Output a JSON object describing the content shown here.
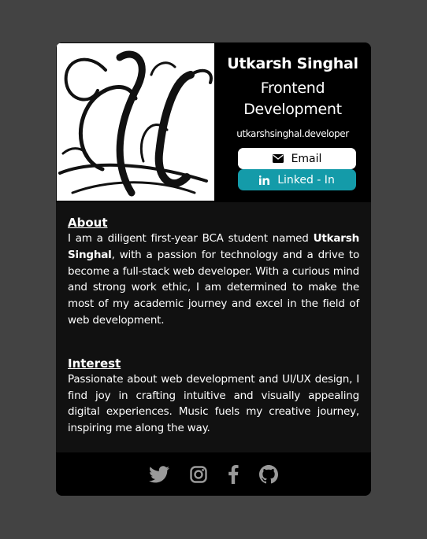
{
  "profile": {
    "name": "Utkarsh Singhal",
    "role": "Frontend Development",
    "handle": "utkarshsinghal.developer",
    "email_label": "Email",
    "linkedin_label": "Linked - In",
    "monogram_letter": "U"
  },
  "about": {
    "heading": "About",
    "text_before": "I am a diligent first-year BCA student named ",
    "text_bold": "Utkarsh Singhal",
    "text_after": ", with a passion for technology and a drive to become a full-stack web developer. With a curious mind and strong work ethic, I am determined to make the most of my academic journey and excel in the field of web development."
  },
  "interest": {
    "heading": "Interest",
    "text": "Passionate about web development and UI/UX design, I find joy in crafting intuitive and visually appealing digital experiences. Music fuels my creative journey, inspiring me along the way."
  },
  "social": [
    "twitter-icon",
    "instagram-icon",
    "facebook-icon",
    "github-icon"
  ],
  "colors": {
    "background": "#434343",
    "card": "#111111",
    "header": "#000000",
    "linkedin_button": "#149ba9",
    "social_icons": "#9a9a9a"
  }
}
